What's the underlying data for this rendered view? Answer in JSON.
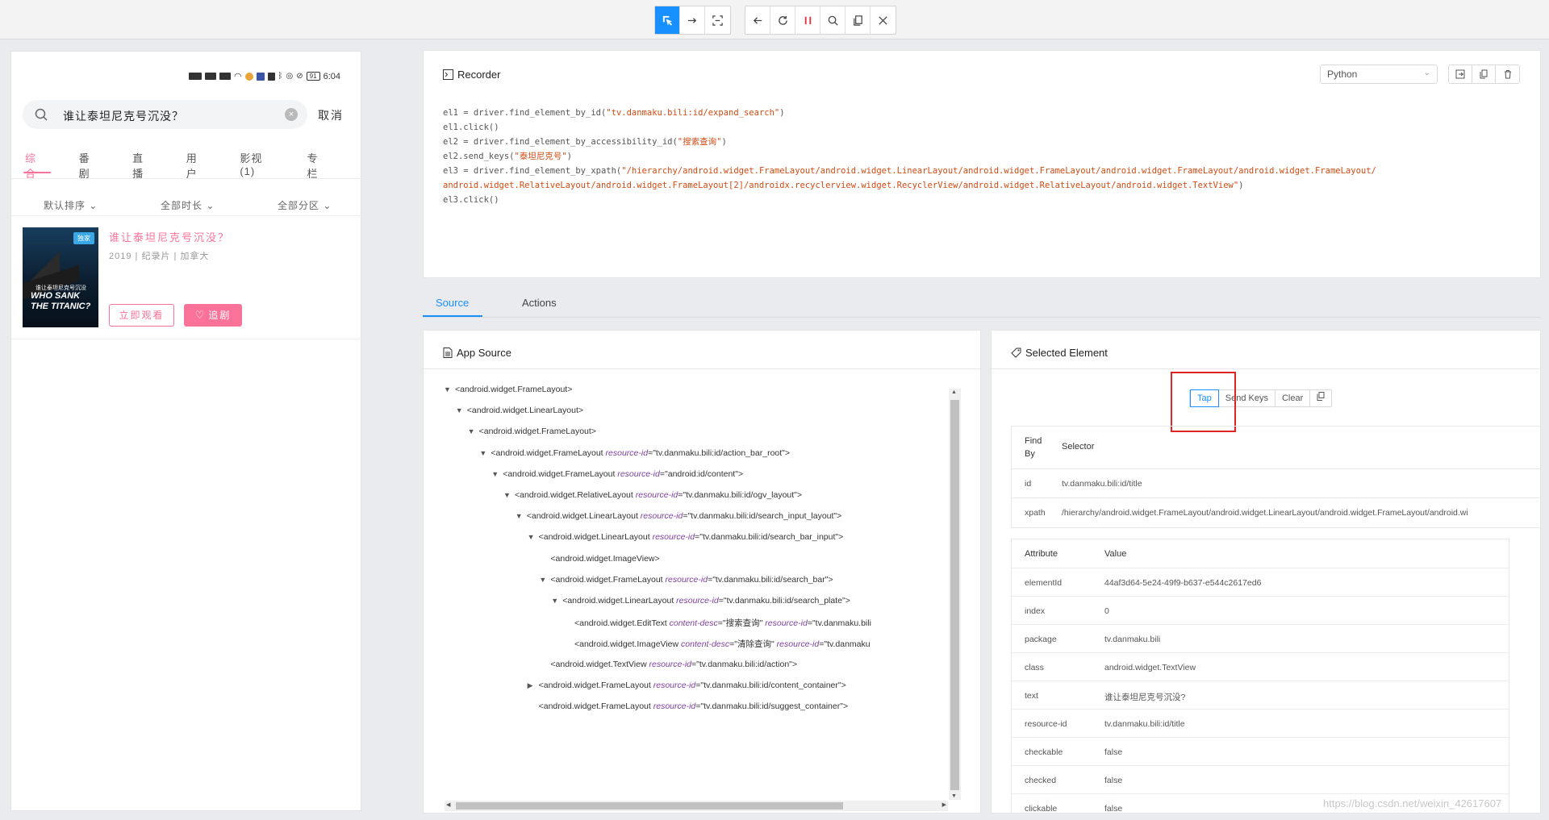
{
  "toolbar": {
    "group1": [
      "select-icon",
      "swipe-icon",
      "tap-by-coordinates-icon"
    ],
    "group2": [
      "back-icon",
      "refresh-icon",
      "pause-icon",
      "search-icon",
      "copy-icon",
      "close-icon"
    ]
  },
  "phone": {
    "status_time": "6:04",
    "status_battery": "91",
    "search_query": "谁让泰坦尼克号沉没？",
    "clear_icon": "×",
    "cancel": "取消",
    "tabs": [
      "综合",
      "番剧",
      "直播",
      "用户",
      "影视(1)",
      "专栏"
    ],
    "filters": [
      "默认排序",
      "全部时长",
      "全部分区"
    ],
    "result": {
      "title": "谁让泰坦尼克号沉没？",
      "meta": "2019 | 纪录片 | 加拿大",
      "badge": "独家",
      "poster_small": "谁让泰坦尼克号沉没",
      "poster_big": "WHO SANK THE TITANIC?",
      "watch": "立即观看",
      "follow": "追剧"
    }
  },
  "recorder": {
    "title": "Recorder",
    "language": "Python",
    "actions": [
      "export-icon",
      "copy-icon",
      "delete-icon"
    ],
    "code": [
      [
        [
          "el1 = driver.find_element_by_id(",
          ""
        ],
        [
          "\"tv.danmaku.bili:id/expand_search\"",
          "s"
        ],
        [
          ")",
          ""
        ]
      ],
      [
        [
          "el1.click()",
          ""
        ]
      ],
      [
        [
          "el2 = driver.find_element_by_accessibility_id(",
          ""
        ],
        [
          "\"搜索查询\"",
          "s"
        ],
        [
          ")",
          ""
        ]
      ],
      [
        [
          "el2.send_keys(",
          ""
        ],
        [
          "\"泰坦尼克号\"",
          "s"
        ],
        [
          ")",
          ""
        ]
      ],
      [
        [
          "el3 = driver.find_element_by_xpath(",
          ""
        ],
        [
          "\"/hierarchy/android.widget.FrameLayout/android.widget.LinearLayout/android.widget.FrameLayout/android.widget.FrameLayout/android.widget.FrameLayout/",
          "s"
        ]
      ],
      [
        [
          "android.widget.RelativeLayout/android.widget.FrameLayout[2]/androidx.recyclerview.widget.RecyclerView/android.widget.RelativeLayout/android.widget.TextView\"",
          "s"
        ],
        [
          ")",
          ""
        ]
      ],
      [
        [
          "el3.click()",
          ""
        ]
      ]
    ]
  },
  "tabs": {
    "source": "Source",
    "actions": "Actions"
  },
  "app_source": {
    "title": "App Source",
    "nodes": [
      {
        "d": 0,
        "t": "v",
        "tag": "<android.widget.FrameLayout>"
      },
      {
        "d": 1,
        "t": "v",
        "tag": "<android.widget.LinearLayout>"
      },
      {
        "d": 2,
        "t": "v",
        "tag": "<android.widget.FrameLayout>"
      },
      {
        "d": 3,
        "t": "v",
        "tag": "<android.widget.FrameLayout",
        "attrs": [
          [
            "resource-id",
            "\"tv.danmaku.bili:id/action_bar_root\""
          ]
        ],
        "end": ">"
      },
      {
        "d": 4,
        "t": "v",
        "tag": "<android.widget.FrameLayout",
        "attrs": [
          [
            "resource-id",
            "\"android:id/content\""
          ]
        ],
        "end": ">"
      },
      {
        "d": 5,
        "t": "v",
        "tag": "<android.widget.RelativeLayout",
        "attrs": [
          [
            "resource-id",
            "\"tv.danmaku.bili:id/ogv_layout\""
          ]
        ],
        "end": ">"
      },
      {
        "d": 6,
        "t": "v",
        "tag": "<android.widget.LinearLayout",
        "attrs": [
          [
            "resource-id",
            "\"tv.danmaku.bili:id/search_input_layout\""
          ]
        ],
        "end": ">"
      },
      {
        "d": 7,
        "t": "v",
        "tag": "<android.widget.LinearLayout",
        "attrs": [
          [
            "resource-id",
            "\"tv.danmaku.bili:id/search_bar_input\""
          ]
        ],
        "end": ">"
      },
      {
        "d": 8,
        "t": "",
        "tag": "<android.widget.ImageView>"
      },
      {
        "d": 8,
        "t": "v",
        "tag": "<android.widget.FrameLayout",
        "attrs": [
          [
            "resource-id",
            "\"tv.danmaku.bili:id/search_bar\""
          ]
        ],
        "end": ">"
      },
      {
        "d": 9,
        "t": "v",
        "tag": "<android.widget.LinearLayout",
        "attrs": [
          [
            "resource-id",
            "\"tv.danmaku.bili:id/search_plate\""
          ]
        ],
        "end": ">"
      },
      {
        "d": 10,
        "t": "",
        "tag": "<android.widget.EditText",
        "attrs": [
          [
            "content-desc",
            "\"搜索查询\""
          ],
          [
            "resource-id",
            "\"tv.danmaku.bili"
          ]
        ],
        "end": ""
      },
      {
        "d": 10,
        "t": "",
        "tag": "<android.widget.ImageView",
        "attrs": [
          [
            "content-desc",
            "\"清除查询\""
          ],
          [
            "resource-id",
            "\"tv.danmaku"
          ]
        ],
        "end": ""
      },
      {
        "d": 8,
        "t": "",
        "tag": "<android.widget.TextView",
        "attrs": [
          [
            "resource-id",
            "\"tv.danmaku.bili:id/action\""
          ]
        ],
        "end": ">"
      },
      {
        "d": 7,
        "t": ">",
        "tag": "<android.widget.FrameLayout",
        "attrs": [
          [
            "resource-id",
            "\"tv.danmaku.bili:id/content_container\""
          ]
        ],
        "end": ">"
      },
      {
        "d": 7,
        "t": "",
        "tag": "<android.widget.FrameLayout",
        "attrs": [
          [
            "resource-id",
            "\"tv.danmaku.bili:id/suggest_container\""
          ]
        ],
        "end": ">"
      }
    ]
  },
  "selected": {
    "title": "Selected Element",
    "actions": [
      "Tap",
      "Send Keys",
      "Clear"
    ],
    "find_header": [
      "Find By",
      "Selector"
    ],
    "find_rows": [
      [
        "id",
        "tv.danmaku.bili:id/title"
      ],
      [
        "xpath",
        "/hierarchy/android.widget.FrameLayout/android.widget.LinearLayout/android.widget.FrameLayout/android.wi"
      ]
    ],
    "attr_header": [
      "Attribute",
      "Value"
    ],
    "attr_rows": [
      [
        "elementId",
        "44af3d64-5e24-49f9-b637-e544c2617ed6"
      ],
      [
        "index",
        "0"
      ],
      [
        "package",
        "tv.danmaku.bili"
      ],
      [
        "class",
        "android.widget.TextView"
      ],
      [
        "text",
        "谁让泰坦尼克号沉没?"
      ],
      [
        "resource-id",
        "tv.danmaku.bili:id/title"
      ],
      [
        "checkable",
        "false"
      ],
      [
        "checked",
        "false"
      ],
      [
        "clickable",
        "false"
      ]
    ]
  },
  "watermark": "https://blog.csdn.net/weixin_42617607"
}
